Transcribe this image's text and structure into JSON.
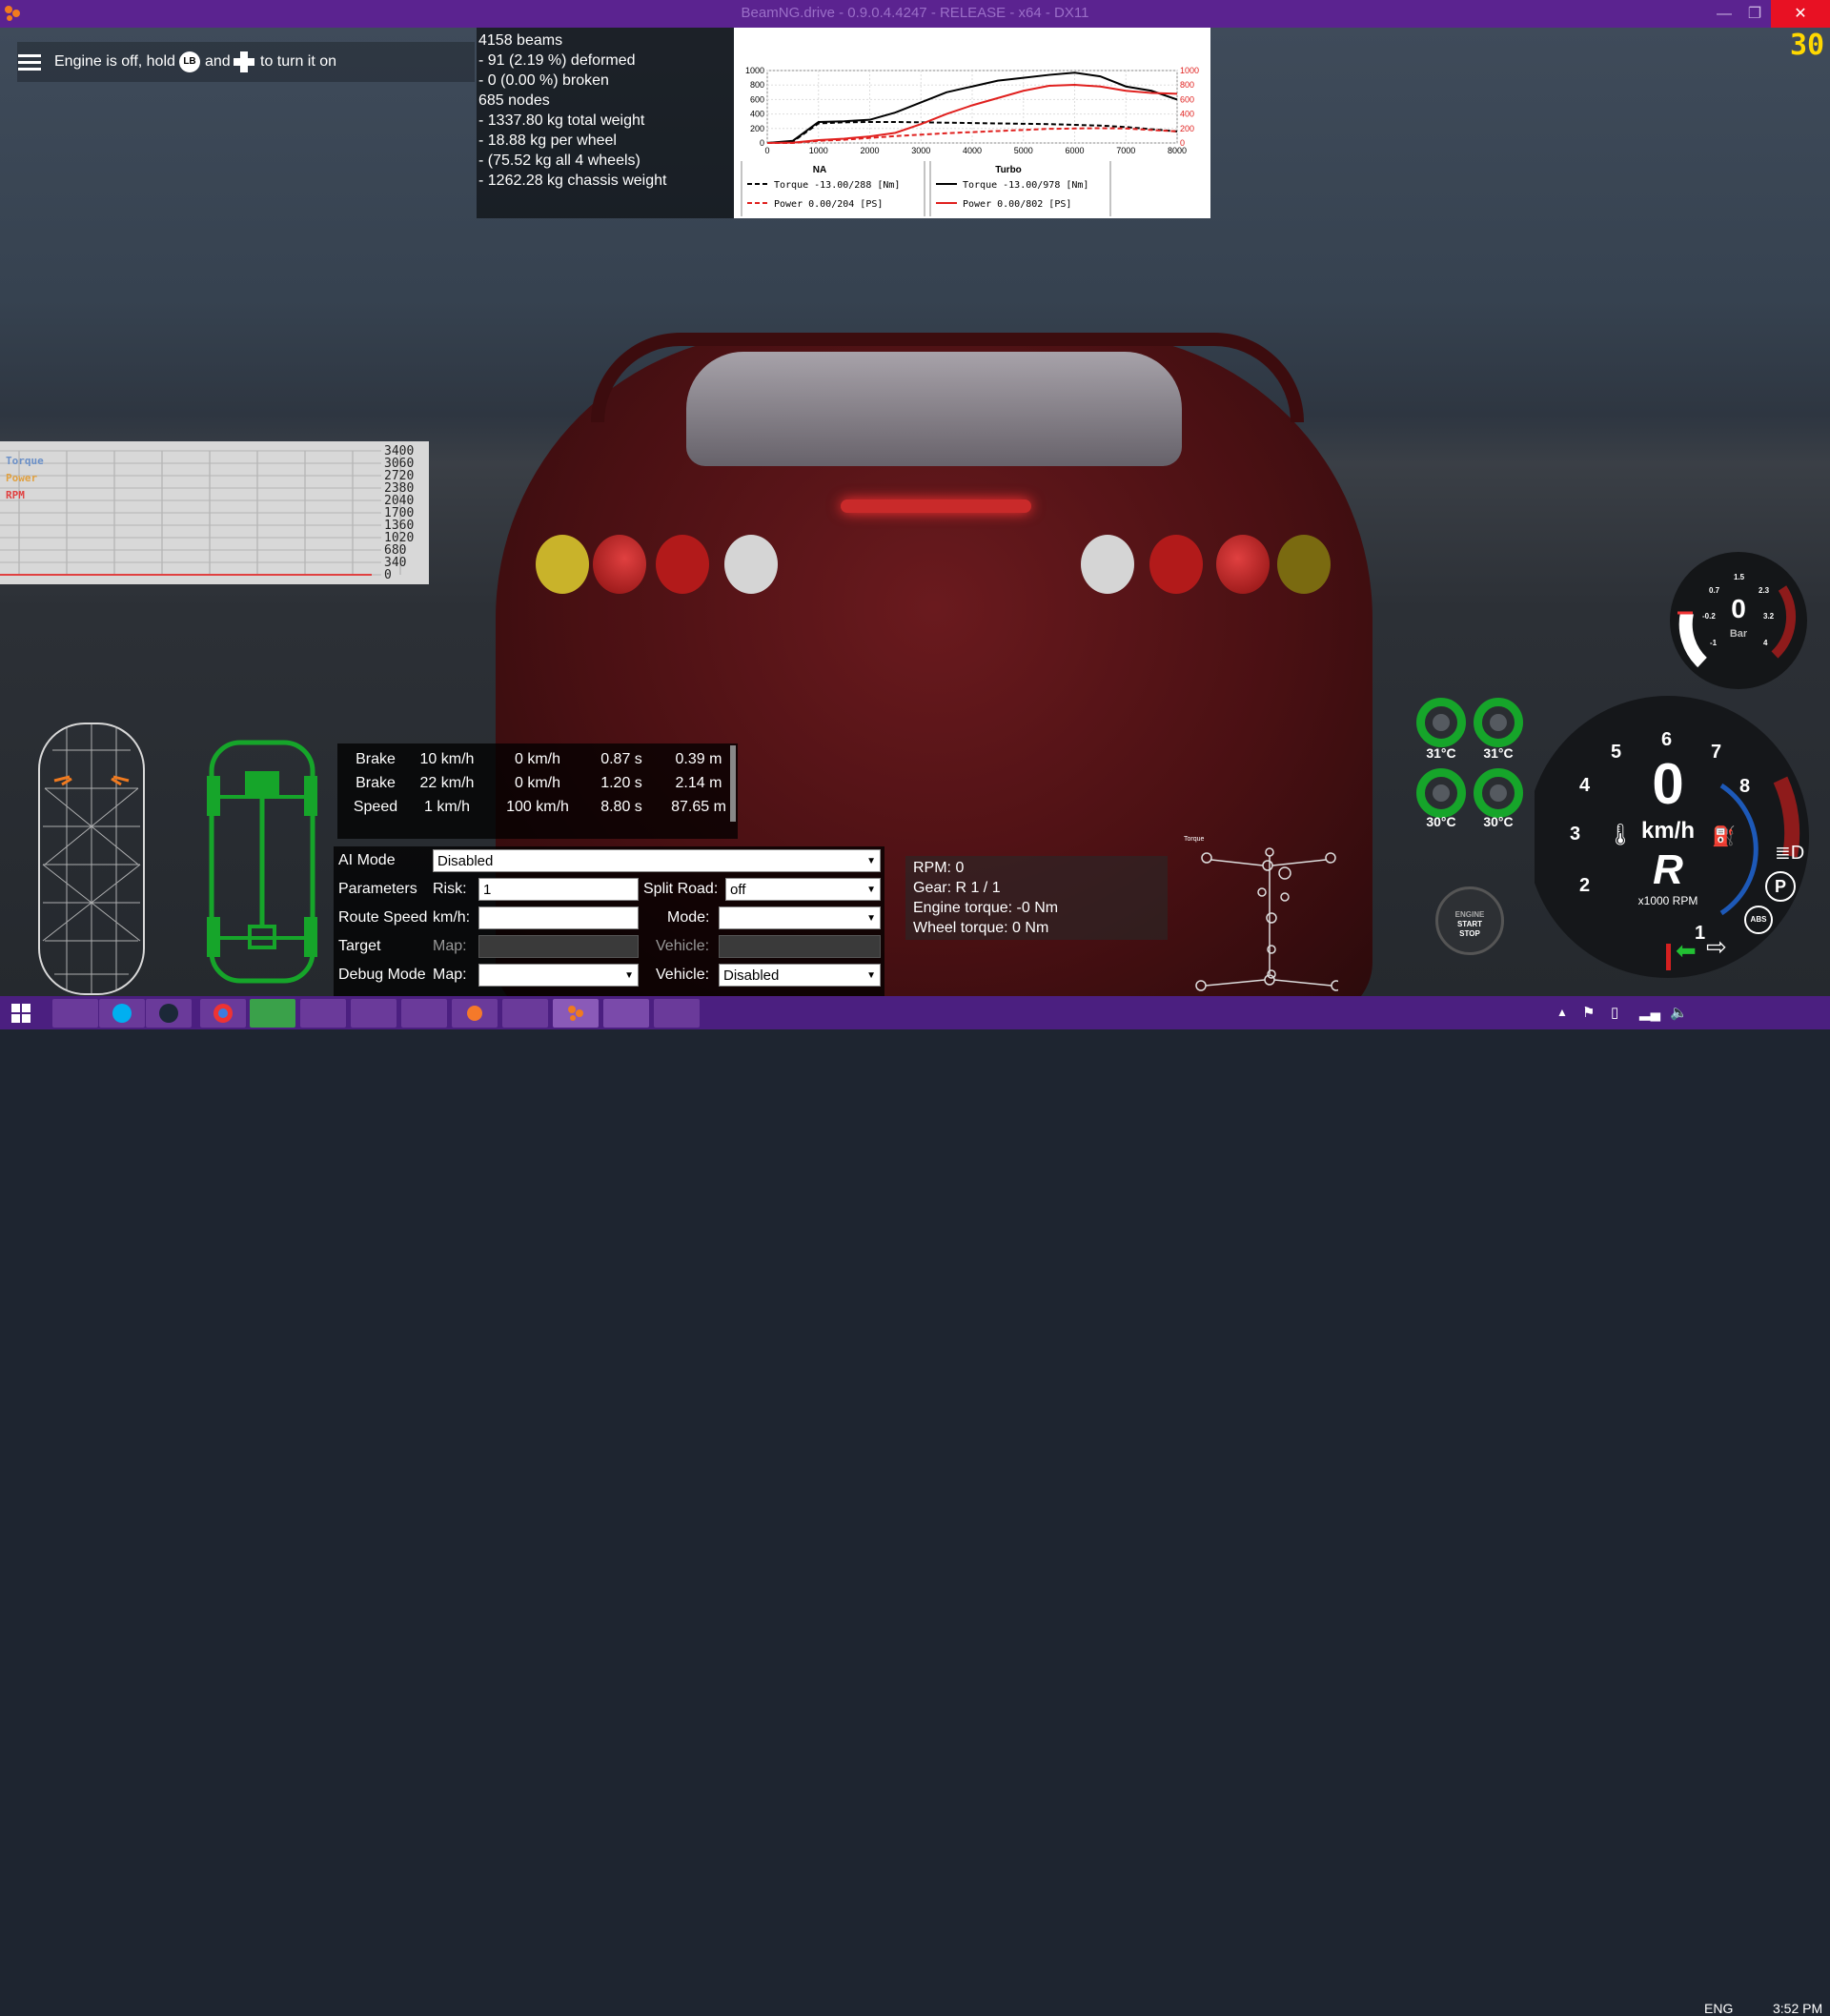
{
  "window": {
    "title": "BeamNG.drive - 0.9.0.4.4247 - RELEASE - x64 - DX11",
    "minimize": "—",
    "maximize": "❐",
    "close": "✕"
  },
  "fps": "30",
  "engine_message": {
    "before": "Engine is off, hold",
    "lb": "LB",
    "and": "and",
    "after": "to turn it on"
  },
  "beams_info": [
    "4158 beams",
    "- 91 (2.19 %) deformed",
    "- 0 (0.00 %) broken",
    "",
    "685 nodes",
    "- 1337.80 kg total weight",
    "- 18.88 kg per wheel",
    "- (75.52 kg all 4 wheels)",
    "- 1262.28 kg chassis weight"
  ],
  "chart_data": [
    {
      "type": "line",
      "x": [
        0,
        500,
        1000,
        1500,
        2000,
        2500,
        3000,
        3500,
        4000,
        4500,
        5000,
        5500,
        6000,
        6500,
        7000,
        7500,
        8000
      ],
      "xlim": [
        0,
        8000
      ],
      "ylim_left": [
        0,
        1000
      ],
      "ylim_right": [
        0,
        1000
      ],
      "x_ticks": [
        "0",
        "1000",
        "2000",
        "3000",
        "4000",
        "5000",
        "6000",
        "7000",
        "8000"
      ],
      "y_ticks": [
        "0",
        "200",
        "400",
        "600",
        "800",
        "1000"
      ],
      "series": [
        {
          "name": "Torque",
          "group": "NA",
          "style": "dashed",
          "color": "#000000",
          "values": [
            0,
            20,
            270,
            285,
            290,
            290,
            285,
            280,
            275,
            270,
            265,
            260,
            250,
            240,
            220,
            190,
            160
          ]
        },
        {
          "name": "Power",
          "group": "NA",
          "style": "dashed",
          "color": "#e0201e",
          "values": [
            0,
            0,
            30,
            45,
            70,
            95,
            115,
            135,
            150,
            165,
            180,
            195,
            200,
            204,
            200,
            180,
            160
          ]
        },
        {
          "name": "Torque",
          "group": "Turbo",
          "style": "solid",
          "color": "#000000",
          "values": [
            0,
            30,
            290,
            300,
            320,
            420,
            560,
            700,
            780,
            860,
            900,
            940,
            970,
            920,
            780,
            720,
            600
          ]
        },
        {
          "name": "Power",
          "group": "Turbo",
          "style": "solid",
          "color": "#e0201e",
          "values": [
            0,
            5,
            40,
            60,
            90,
            140,
            260,
            400,
            520,
            620,
            720,
            790,
            802,
            780,
            720,
            690,
            680
          ]
        }
      ],
      "groups": [
        "NA",
        "Turbo"
      ],
      "legend": [
        {
          "group": "NA",
          "label": "Torque",
          "value": "-13.00/288",
          "unit": "[Nm]"
        },
        {
          "group": "NA",
          "label": "Power",
          "value": "0.00/204",
          "unit": "[PS]"
        },
        {
          "group": "Turbo",
          "label": "Torque",
          "value": "-13.00/978",
          "unit": "[Nm]"
        },
        {
          "group": "Turbo",
          "label": "Power",
          "value": "0.00/802",
          "unit": "[PS]"
        }
      ]
    },
    {
      "type": "line",
      "legend": [
        "Torque",
        "Power",
        "RPM"
      ],
      "y_ticks": [
        "3400",
        "3060",
        "2720",
        "2380",
        "2040",
        "1700",
        "1360",
        "1020",
        "680",
        "340",
        "0"
      ],
      "ylim": [
        0,
        3400
      ],
      "series": [
        {
          "name": "RPM",
          "values": [
            0,
            0,
            0,
            0,
            0,
            0,
            0,
            0
          ]
        }
      ]
    }
  ],
  "brake_table": {
    "rows": [
      [
        "Brake",
        "10 km/h",
        "0 km/h",
        "0.87 s",
        "0.39 m"
      ],
      [
        "Brake",
        "22 km/h",
        "0 km/h",
        "1.20 s",
        "2.14 m"
      ],
      [
        "Speed",
        "1 km/h",
        "100 km/h",
        "8.80 s",
        "87.65 m"
      ]
    ]
  },
  "ai_panel": {
    "ai_mode_label": "AI Mode",
    "ai_mode_value": "Disabled",
    "parameters_label": "Parameters",
    "risk_label": "Risk:",
    "risk_value": "1",
    "split_road_label": "Split Road:",
    "split_road_value": "off",
    "route_speed_label": "Route Speed",
    "kmh_label": "km/h:",
    "mode_label": "Mode:",
    "target_label": "Target",
    "map_label": "Map:",
    "vehicle_label": "Vehicle:",
    "debug_mode_label": "Debug Mode",
    "debug_map_label": "Map:",
    "debug_vehicle_label": "Vehicle:",
    "debug_vehicle_value": "Disabled"
  },
  "rpm_info": [
    "RPM: 0",
    "Gear: R 1 / 1",
    "Engine torque: -0 Nm",
    "Wheel torque: 0 Nm"
  ],
  "pedal_label": "Torque",
  "boost_gauge": {
    "value": "0",
    "unit": "Bar",
    "ticks": [
      "-1",
      "-0.2",
      "0.7",
      "1.5",
      "2.3",
      "3.2",
      "4"
    ]
  },
  "speedo": {
    "speed": "0",
    "unit": "km/h",
    "gear": "R",
    "rpm_label": "x1000 RPM",
    "ticks": [
      "1",
      "2",
      "3",
      "4",
      "5",
      "6",
      "7",
      "8"
    ]
  },
  "temps": [
    "31°C",
    "31°C",
    "30°C",
    "30°C"
  ],
  "start_stop": [
    "ENGINE",
    "START",
    "STOP"
  ],
  "abs_label": "ABS",
  "park_label": "P",
  "taskbar": {
    "lang": "ENG",
    "time": "3:52 PM"
  }
}
